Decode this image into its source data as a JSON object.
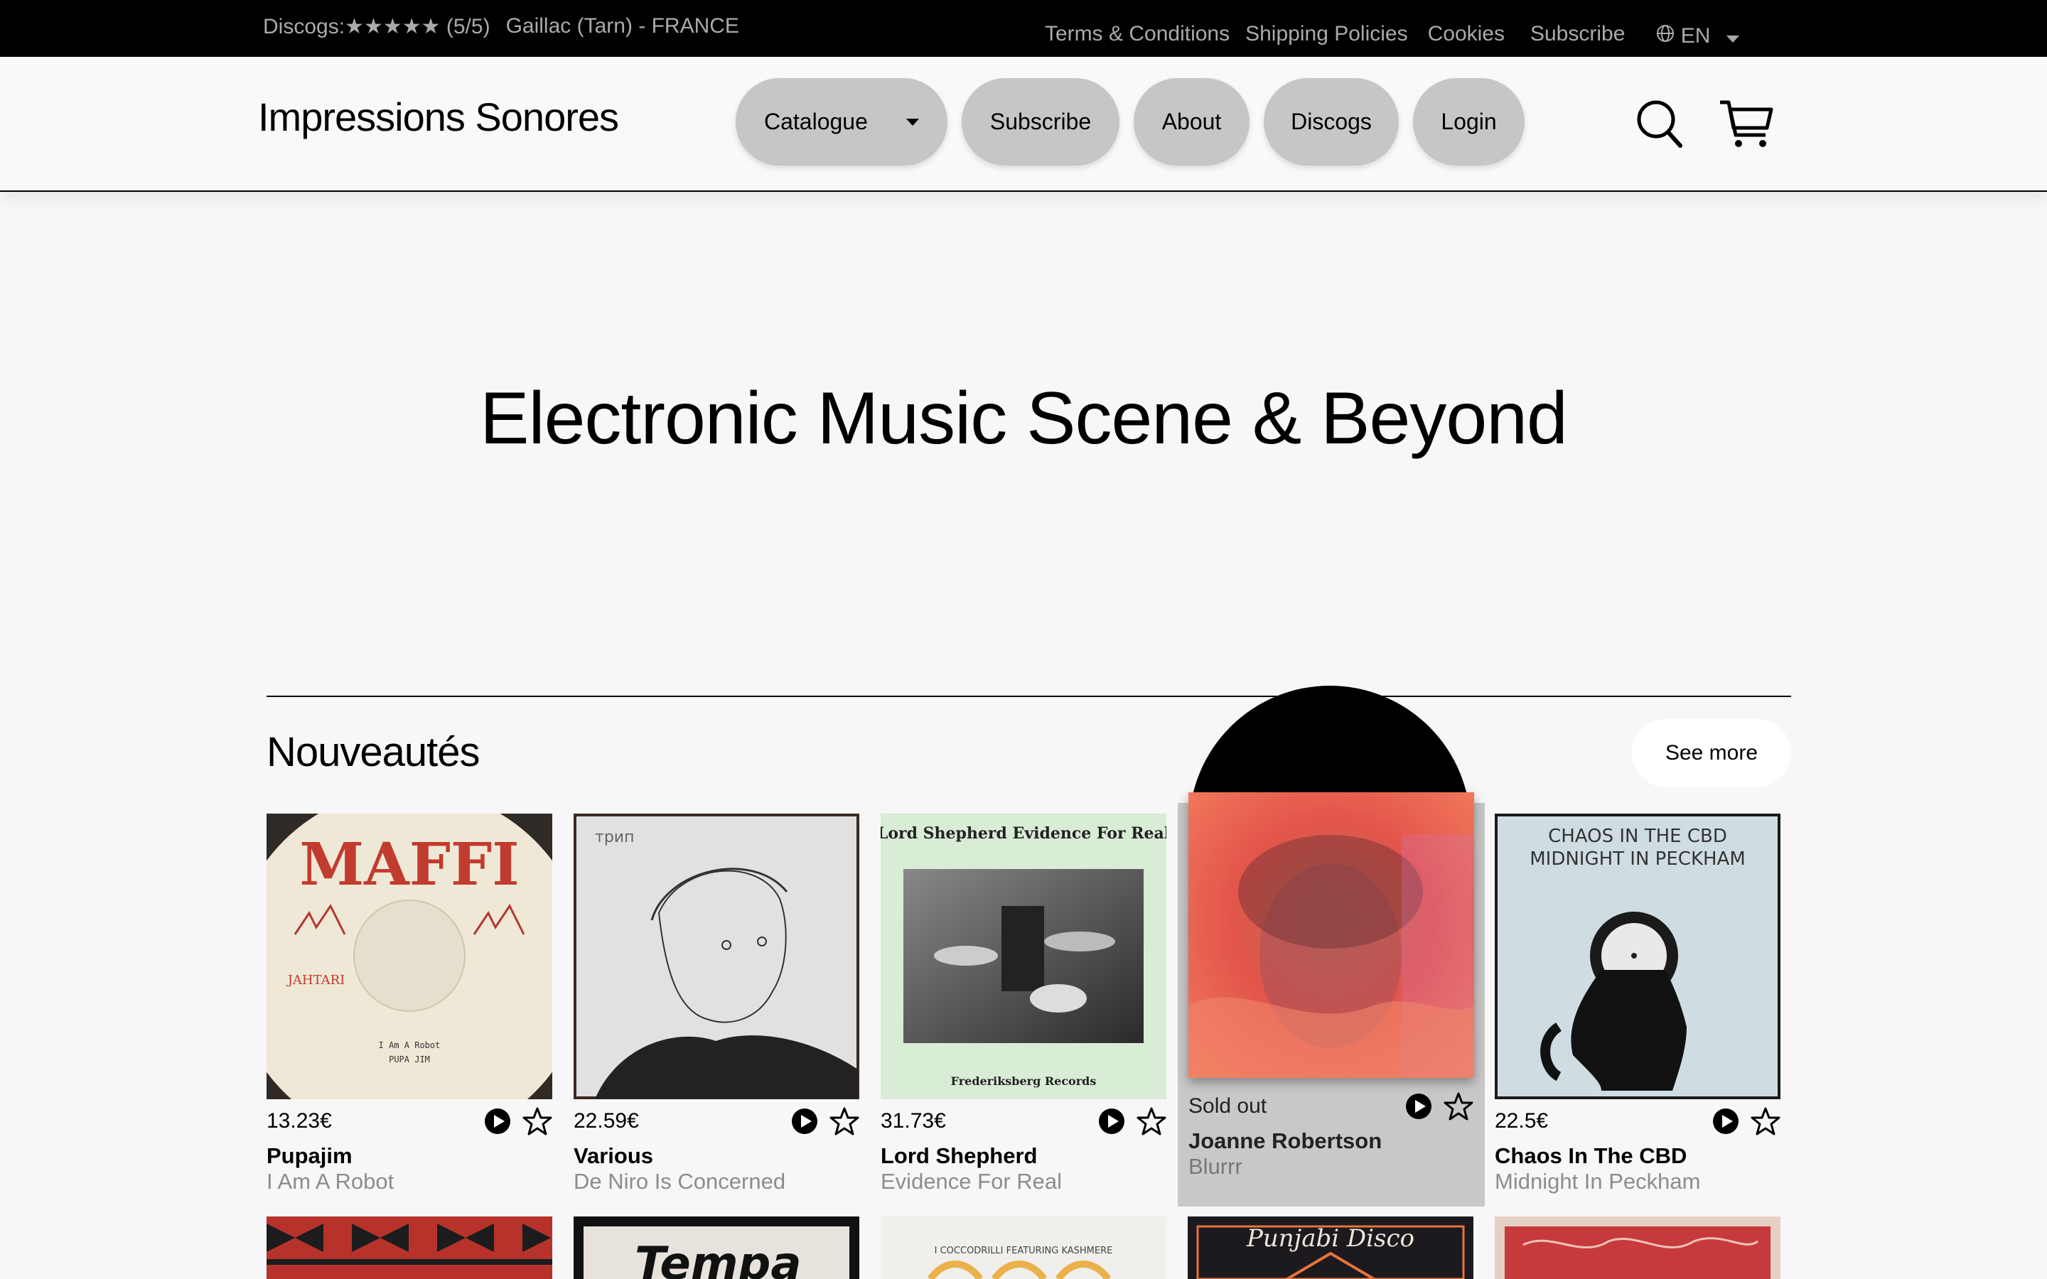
{
  "topbar": {
    "discogs_label": "Discogs:",
    "rating_stars": "★★★★★",
    "rating_text": "(5/5)",
    "location": "Gaillac (Tarn) - FRANCE",
    "links": [
      "Terms & Conditions",
      "Shipping Policies",
      "Cookies",
      "Subscribe"
    ],
    "language": "EN"
  },
  "header": {
    "brand": "Impressions Sonores",
    "nav": [
      "Catalogue",
      "Subscribe",
      "About",
      "Discogs",
      "Login"
    ]
  },
  "hero": {
    "title": "Electronic Music Scene & Beyond"
  },
  "section": {
    "title": "Nouveautés",
    "see_more": "See more"
  },
  "products": [
    {
      "price": "13.23€",
      "artist": "Pupajim",
      "title": "I Am A Robot",
      "cover_text": "MAFFI",
      "sold_out": false
    },
    {
      "price": "22.59€",
      "artist": "Various",
      "title": "De Niro Is Concerned",
      "cover_text": "трип",
      "sold_out": false
    },
    {
      "price": "31.73€",
      "artist": "Lord Shepherd",
      "title": "Evidence For Real",
      "cover_text": "Lord Shepherd   Evidence For Real",
      "cover_subtext": "Frederiksberg Records",
      "sold_out": false
    },
    {
      "price": "Sold out",
      "artist": "Joanne Robertson",
      "title": "Blurrr",
      "sold_out": true
    },
    {
      "price": "22.5€",
      "artist": "Chaos In The CBD",
      "title": "Midnight In Peckham",
      "cover_text": "CHAOS IN THE CBD",
      "cover_subtext": "MIDNIGHT IN PECKHAM",
      "sold_out": false
    }
  ],
  "next_row": [
    {
      "cover_text": ""
    },
    {
      "cover_text": "Tempa"
    },
    {
      "cover_text": "I COCCODRILLI FEATURING KASHMERE"
    },
    {
      "cover_text": "Punjabi Disco"
    },
    {
      "cover_text": ""
    }
  ],
  "colors": {
    "topbar_bg": "#000000",
    "pill_bg": "#c6c6c6",
    "sold_bg": "#c8c8c8",
    "muted_text": "#8c8c8c"
  }
}
